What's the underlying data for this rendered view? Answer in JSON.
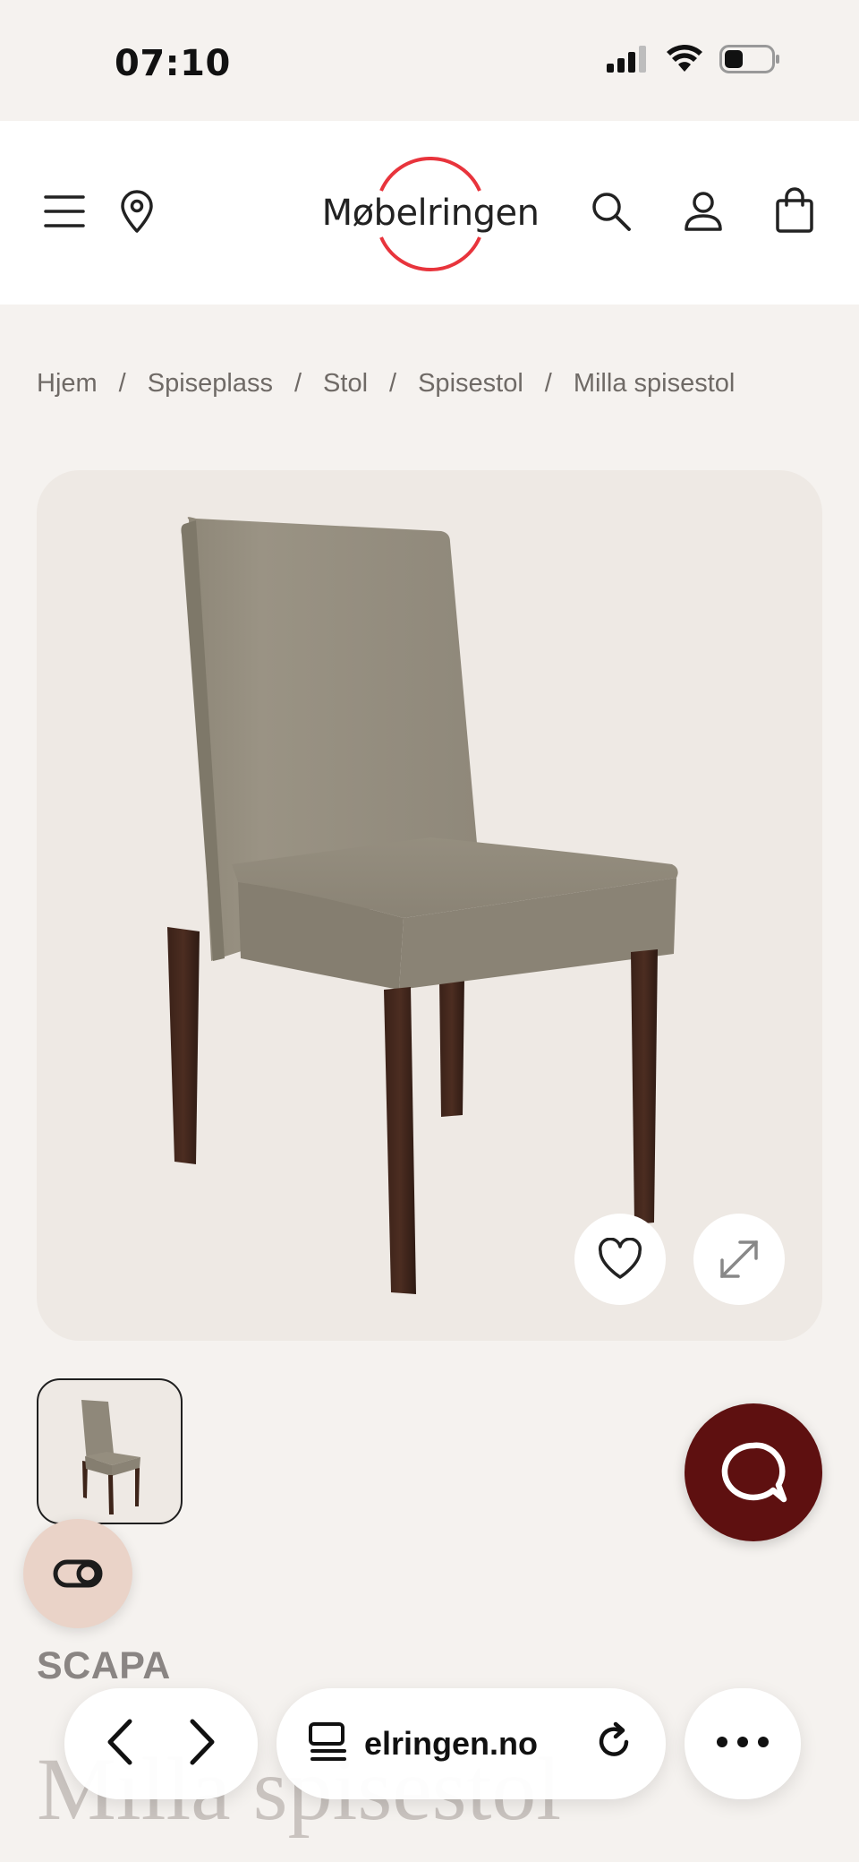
{
  "status_bar": {
    "time": "07:10",
    "icons": [
      "signal-icon",
      "wifi-icon",
      "battery-icon"
    ]
  },
  "header": {
    "logo_text": "Møbelringen",
    "icons": [
      "menu-icon",
      "location-pin-icon",
      "search-icon",
      "account-icon",
      "shopping-bag-icon"
    ],
    "logo_ring_color": "#e8343c"
  },
  "breadcrumb": {
    "items": [
      "Hjem",
      "Spiseplass",
      "Stol",
      "Spisestol",
      "Milla spisestol"
    ],
    "separator": "/"
  },
  "product": {
    "brand": "SCAPA",
    "title": "Milla spisestol",
    "image_actions": [
      "heart-icon",
      "expand-icon"
    ]
  },
  "floating": {
    "chat_icon": "chat-bubble-icon",
    "chat_color": "#5e1010",
    "compare_icon": "compare-toggle-icon"
  },
  "browser_bar": {
    "url": "elringen.no",
    "icons": [
      "back-icon",
      "forward-icon",
      "reader-icon",
      "reload-icon",
      "more-icon"
    ]
  }
}
